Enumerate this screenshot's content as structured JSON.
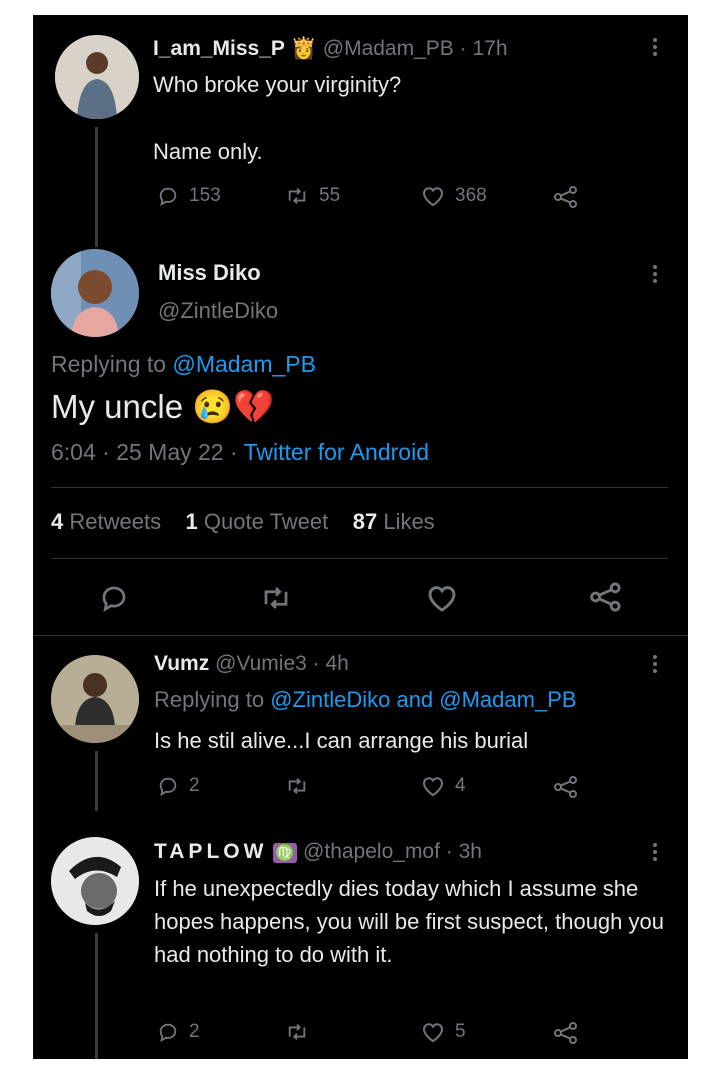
{
  "tweet1": {
    "display_name": "I_am_Miss_P",
    "badge_emoji": "👸",
    "handle": "@Madam_PB",
    "time": "· 17h",
    "line1": "Who broke your virginity?",
    "line2": "Name only.",
    "replies": "153",
    "retweets": "55",
    "likes": "368"
  },
  "main": {
    "display_name": "Miss Diko",
    "handle": "@ZintleDiko",
    "replying_label": "Replying to",
    "replying_to": "@Madam_PB",
    "text": "My uncle",
    "emojis": "😢💔",
    "timestamp": "6:04 · 25 May 22 · ",
    "source": "Twitter for Android",
    "stats": {
      "retweets_count": "4",
      "retweets_label": "Retweets",
      "quotes_count": "1",
      "quotes_label": "Quote Tweet",
      "likes_count": "87",
      "likes_label": "Likes"
    }
  },
  "reply1": {
    "display_name": "Vumz",
    "handle": "@Vumie3",
    "time": "· 4h",
    "replying_label": "Replying to",
    "replying_to": "@ZintleDiko and @Madam_PB",
    "text": "Is he stil alive...I can arrange his burial",
    "replies": "2",
    "retweets": "",
    "likes": "4"
  },
  "reply2": {
    "display_name": "TAPLOW",
    "badge_emoji": "♍",
    "handle": "@thapelo_mof",
    "time": "· 3h",
    "text": "If he unexpectedly dies today which I assume she hopes happens, you will be first suspect, though you had nothing to do with it.",
    "replies": "2",
    "retweets": "",
    "likes": "5"
  },
  "colors": {
    "background": "#000000",
    "text": "#e7e9ea",
    "muted": "#71767b",
    "link": "#1d9bf0"
  }
}
